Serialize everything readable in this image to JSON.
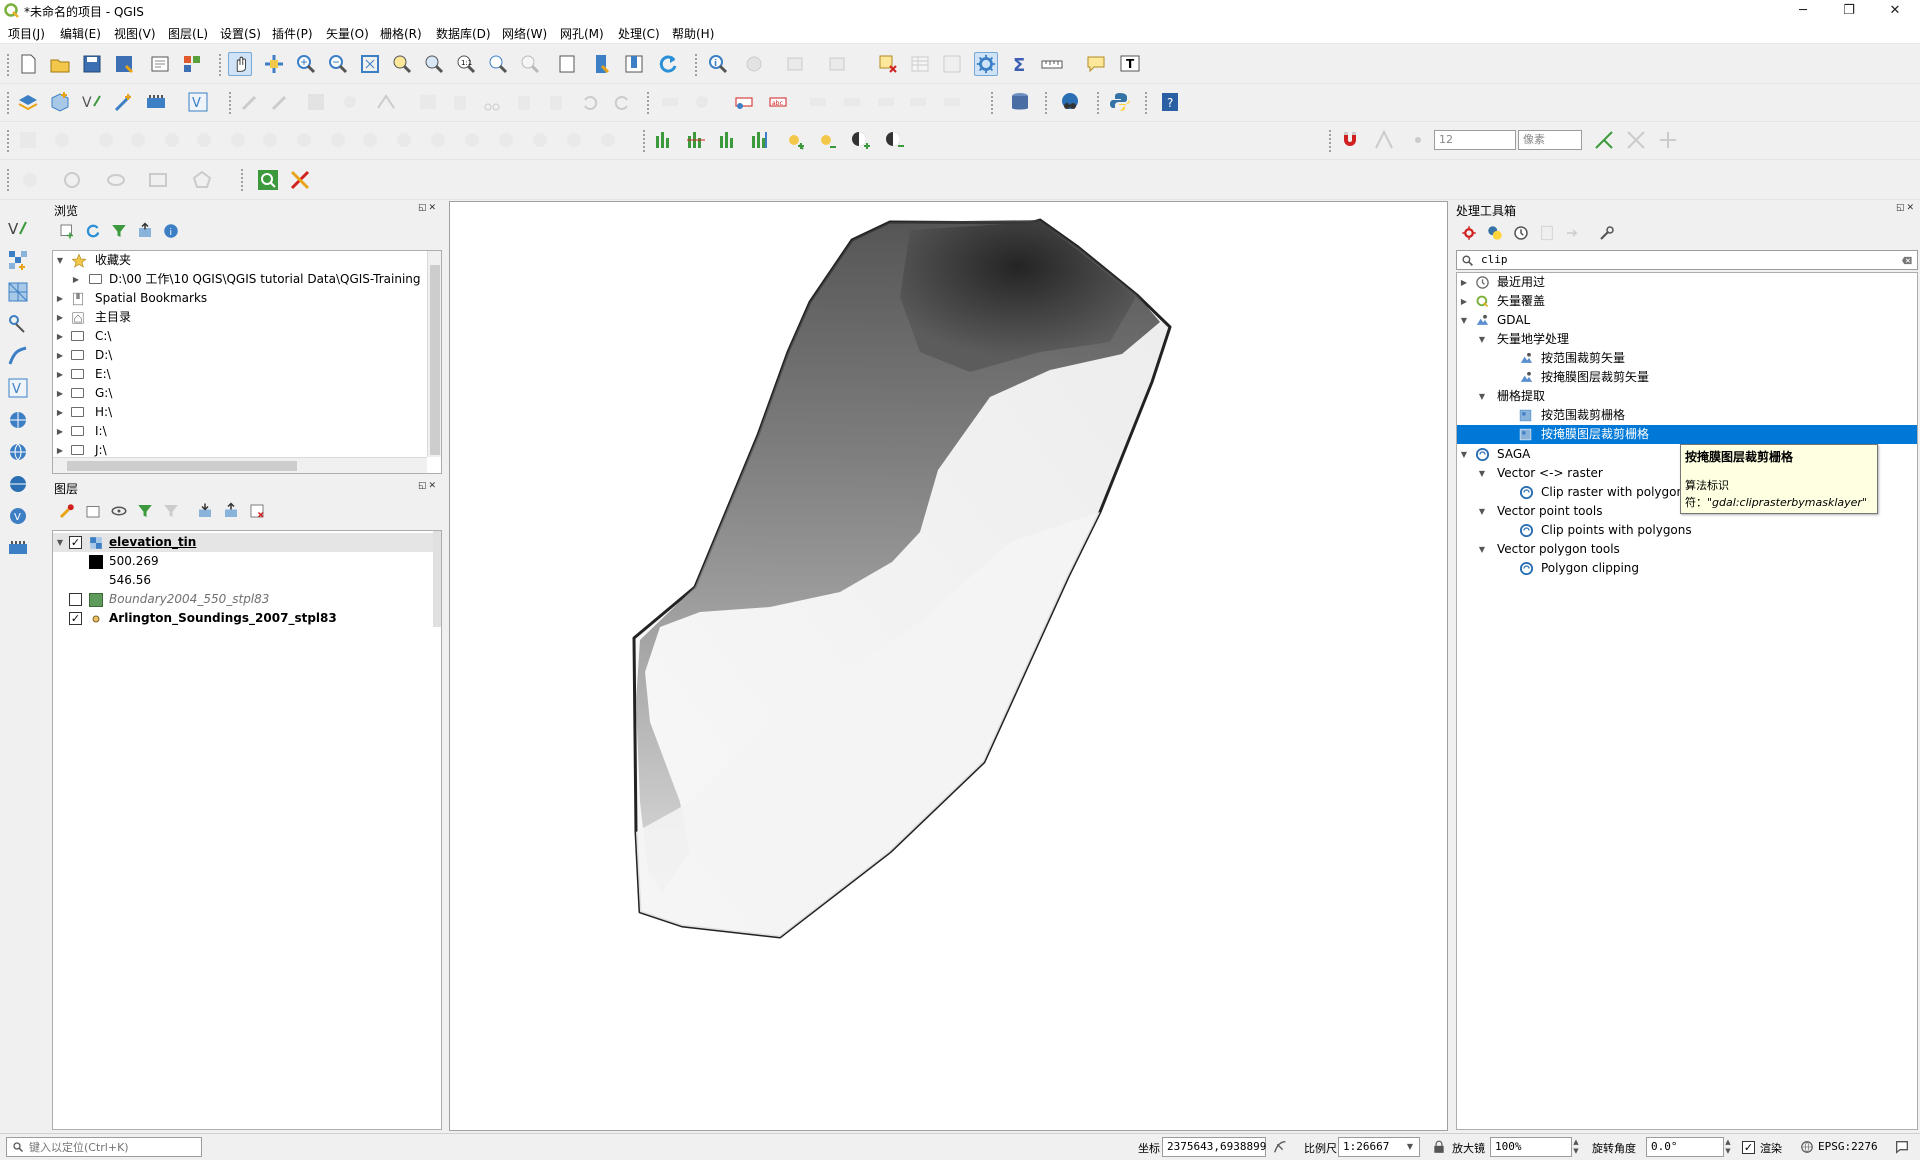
{
  "window": {
    "title": "*未命名的项目 - QGIS",
    "minimize": "─",
    "maximize": "❐",
    "close": "✕"
  },
  "menu": [
    "项目(J)",
    "编辑(E)",
    "视图(V)",
    "图层(L)",
    "设置(S)",
    "插件(P)",
    "矢量(O)",
    "栅格(R)",
    "数据库(D)",
    "网络(W)",
    "网孔(M)",
    "处理(C)",
    "帮助(H)"
  ],
  "snapping": {
    "tolerance": "12",
    "unit": "像素"
  },
  "browser": {
    "title": "浏览",
    "items": [
      {
        "label": "收藏夹",
        "expanded": true,
        "icon": "star-icon"
      },
      {
        "label": "D:\\00 工作\\10 QGIS\\QGIS tutorial Data\\QGIS-Training",
        "icon": "folder-icon"
      },
      {
        "label": "Spatial Bookmarks",
        "icon": "bookmark-icon"
      },
      {
        "label": "主目录",
        "icon": "home-icon"
      },
      {
        "label": "C:\\",
        "icon": "folder-icon"
      },
      {
        "label": "D:\\",
        "icon": "folder-icon"
      },
      {
        "label": "E:\\",
        "icon": "folder-icon"
      },
      {
        "label": "G:\\",
        "icon": "folder-icon"
      },
      {
        "label": "H:\\",
        "icon": "folder-icon"
      },
      {
        "label": "I:\\",
        "icon": "folder-icon"
      },
      {
        "label": "J:\\",
        "icon": "folder-icon"
      }
    ]
  },
  "layers": {
    "title": "图层",
    "items": [
      {
        "name": "elevation_tin",
        "checked": true
      },
      {
        "legend_min": "500.269"
      },
      {
        "legend_max": "546.56"
      },
      {
        "name": "Boundary2004_550_stpl83",
        "checked": false,
        "color": "#5e9a5a"
      },
      {
        "name": "Arlington_Soundings_2007_stpl83",
        "checked": true
      }
    ]
  },
  "toolbox": {
    "title": "处理工具箱",
    "search_value": "clip",
    "tree": [
      "最近用过",
      "矢量覆盖",
      "GDAL",
      "矢量地学处理",
      "按范围裁剪矢量",
      "按掩膜图层裁剪矢量",
      "栅格提取",
      "按范围裁剪栅格",
      "按掩膜图层裁剪栅格",
      "SAGA",
      "Vector <-> raster",
      "Clip raster with polygon",
      "Vector point tools",
      "Clip points with polygons",
      "Vector polygon tools",
      "Polygon clipping"
    ],
    "tooltip": {
      "title": "按掩膜图层裁剪栅格",
      "line1": "算法标识",
      "line2_prefix": "符：",
      "line2_id": "\"gdal:cliprasterbymasklayer\""
    }
  },
  "statusbar": {
    "locate_placeholder": "键入以定位(Ctrl+K)",
    "coord_label": "坐标",
    "coord_value": "2375643,6938899",
    "scale_label": "比例尺",
    "scale_value": "1:26667",
    "magnifier_label": "放大镜",
    "magnifier_value": "100%",
    "rotation_label": "旋转角度",
    "rotation_value": "0.0°",
    "render_label": "渲染",
    "crs": "EPSG:2276"
  },
  "colors": {
    "selection": "#0078d7",
    "tooltip_bg": "#ffffe1",
    "accent": "#3c7fc4"
  }
}
